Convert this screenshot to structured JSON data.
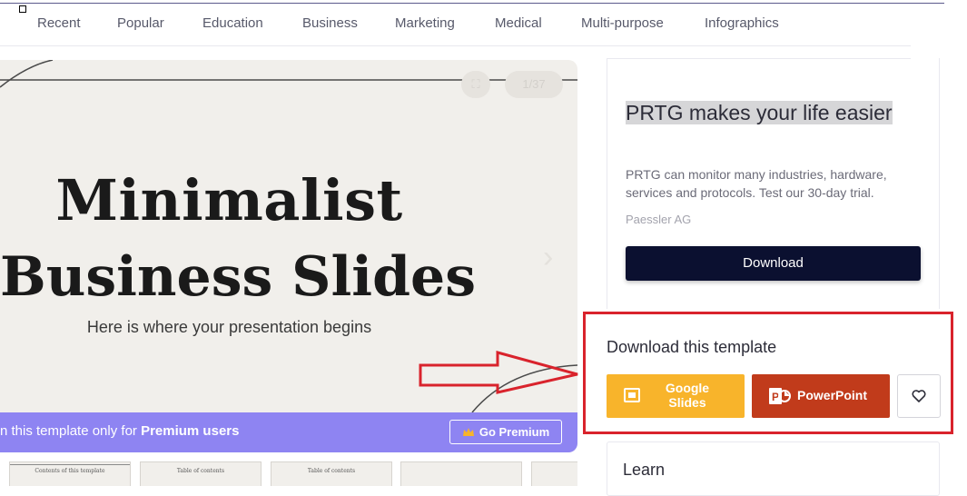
{
  "nav": {
    "items": [
      "Recent",
      "Popular",
      "Education",
      "Business",
      "Marketing",
      "Medical",
      "Multi-purpose",
      "Infographics"
    ]
  },
  "preview": {
    "slide_title_line1": "Minimalist",
    "slide_title_line2": "Business Slides",
    "slide_subtitle": "Here is where your presentation begins",
    "slide_counter": "1/37",
    "premium_text_prefix": "n this template only for ",
    "premium_text_bold": "Premium users",
    "go_premium_label": "Go Premium"
  },
  "thumbnails": [
    {
      "label": "Contents of this template"
    },
    {
      "label": "Table of contents"
    },
    {
      "label": "Table of contents"
    },
    {
      "label": ""
    },
    {
      "label": ""
    }
  ],
  "ad": {
    "title": "PRTG makes your life easier",
    "description": "PRTG can monitor many industries, hardware, services and protocols. Test our 30-day trial.",
    "company": "Paessler AG",
    "download_label": "Download"
  },
  "download_section": {
    "title": "Download this template",
    "google_slides_label": "Google Slides",
    "powerpoint_label": "PowerPoint"
  },
  "learn": {
    "title": "Learn"
  },
  "colors": {
    "premium_bar": "#8e84f2",
    "google_slides": "#f8b42b",
    "powerpoint": "#c13b1b",
    "ad_button": "#0b1030",
    "annotation_red": "#d9232c"
  },
  "icons": [
    "slides-icon",
    "powerpoint-icon",
    "heart-icon",
    "crown-icon",
    "chevron-right-icon",
    "fullscreen-icon"
  ]
}
